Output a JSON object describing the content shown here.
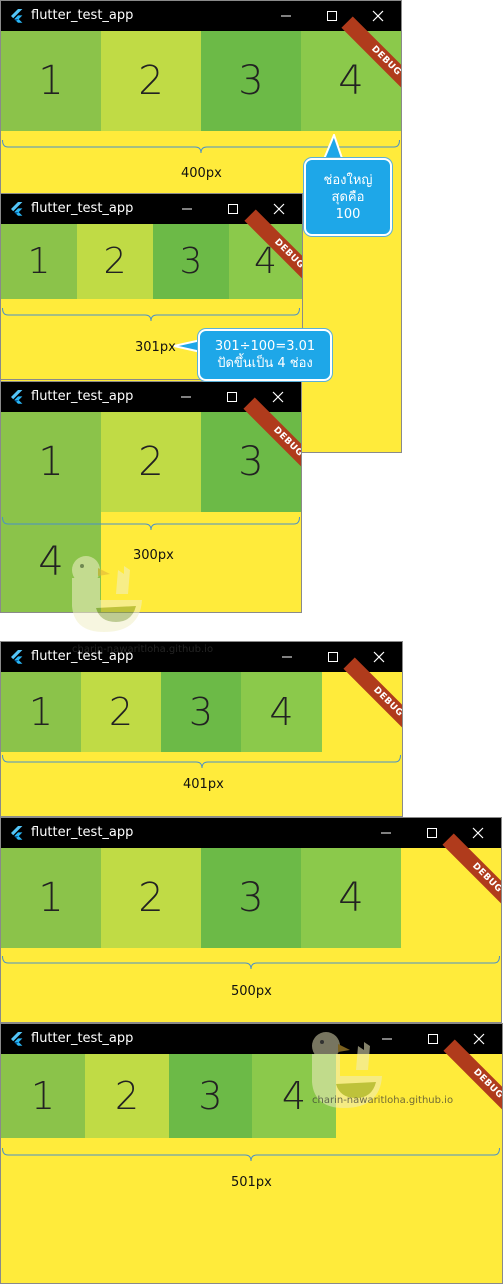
{
  "app_title": "flutter_test_app",
  "debug_label": "DEBUG",
  "cells": [
    "1",
    "2",
    "3",
    "4"
  ],
  "colors": {
    "cell1": "#8bc34a",
    "cell2": "#c0db45",
    "cell3": "#6cba47",
    "cell4": "#8bc94b",
    "background": "#ffeb3b",
    "titlebar": "#000000",
    "callout": "#1ea7e8",
    "ribbon": "#b03b1c"
  },
  "icons": {
    "logo": "flutter-logo-icon",
    "minimize": "minimize-icon",
    "maximize": "maximize-icon",
    "close": "close-icon"
  },
  "widths": {
    "w400": "400px",
    "w301": "301px",
    "w300": "300px",
    "w401": "401px",
    "w500": "500px",
    "w501": "501px"
  },
  "callouts": {
    "max_cell": {
      "line1": "ช่องใหญ่",
      "line2": "สุดคือ",
      "line3": "100"
    },
    "calc": {
      "line1": "301÷100=3.01",
      "line2": "ปัดขึ้นเป็น 4 ช่อง"
    }
  },
  "watermark": "charin-nawaritloha.github.io"
}
